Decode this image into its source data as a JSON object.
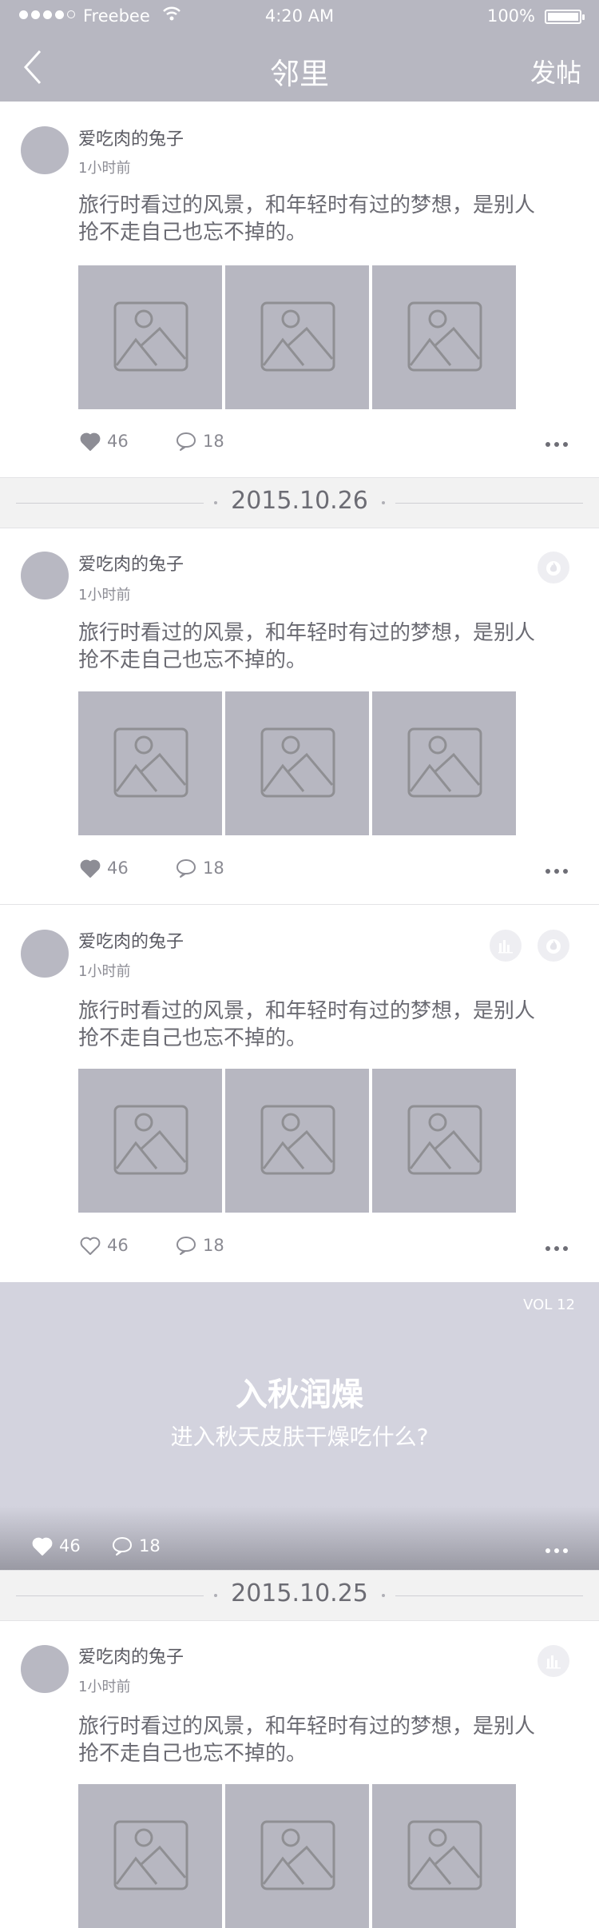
{
  "status_bar": {
    "carrier": "Freebee",
    "time": "4:20 AM",
    "battery": "100%"
  },
  "nav": {
    "title": "邻里",
    "action": "发帖"
  },
  "posts": [
    {
      "username": "爱吃肉的兔子",
      "time": "1小时前",
      "text_line1": "旅行时看过的风景，和年轻时有过的梦想，是别人",
      "text_line2": "抢不走自己也忘不掉的。",
      "likes": "46",
      "comments": "18"
    },
    {
      "username": "爱吃肉的兔子",
      "time": "1小时前",
      "text_line1": "旅行时看过的风景，和年轻时有过的梦想，是别人",
      "text_line2": "抢不走自己也忘不掉的。",
      "likes": "46",
      "comments": "18"
    },
    {
      "username": "爱吃肉的兔子",
      "time": "1小时前",
      "text_line1": "旅行时看过的风景，和年轻时有过的梦想，是别人",
      "text_line2": "抢不走自己也忘不掉的。",
      "likes": "46",
      "comments": "18"
    },
    {
      "username": "爱吃肉的兔子",
      "time": "1小时前",
      "text_line1": "旅行时看过的风景，和年轻时有过的梦想，是别人",
      "text_line2": "抢不走自己也忘不掉的。"
    }
  ],
  "dates": [
    "2015.10.26",
    "2015.10.25"
  ],
  "banner": {
    "vol": "VOL 12",
    "title": "入秋润燥",
    "subtitle": "进入秋天皮肤干燥吃什么?",
    "likes": "46",
    "comments": "18"
  },
  "icons": {
    "back": "chevron-left-icon",
    "like": "heart-icon",
    "comment": "comment-bubble-icon",
    "more": "more-dots-icon",
    "hot": "flame-icon",
    "chart": "bar-chart-icon",
    "image": "image-placeholder-icon"
  },
  "colors": {
    "nav_bg": "#b7b7c1",
    "placeholder": "#b7b7c1",
    "banner_bg": "#d3d3de",
    "date_bg": "#f2f2f2"
  }
}
